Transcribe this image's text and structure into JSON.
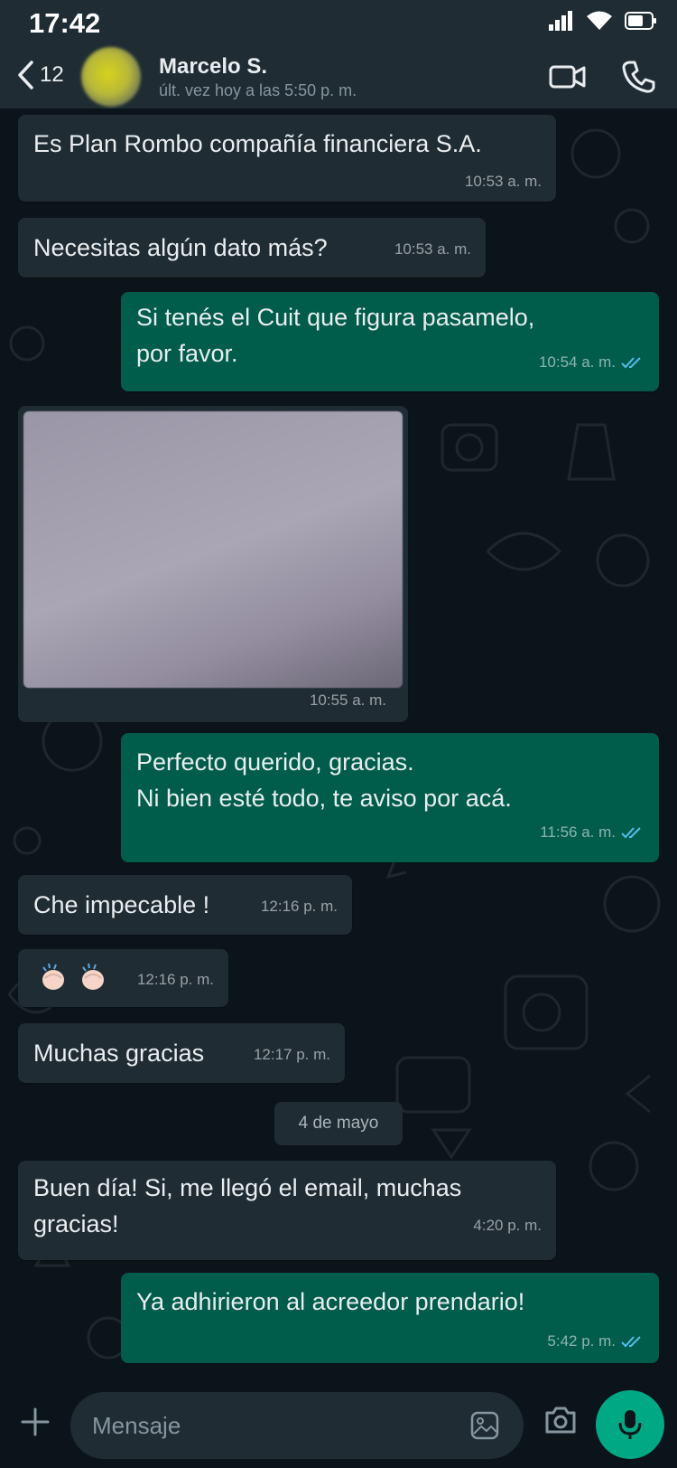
{
  "status_bar": {
    "time": "17:42"
  },
  "header": {
    "back_count": "12",
    "contact_name": "Marcelo S.",
    "last_seen": "últ. vez hoy a las 5:50 p. m."
  },
  "messages": [
    {
      "direction": "in",
      "text": "Es Plan Rombo compañía financiera S.A.",
      "time": "10:53 a. m."
    },
    {
      "direction": "in",
      "text": "Necesitas algún dato más?",
      "time": "10:53 a. m."
    },
    {
      "direction": "out",
      "text_lines": [
        "Si tenés el Cuit que figura pasamelo,",
        "por favor."
      ],
      "time": "10:54 a. m.",
      "read": true
    },
    {
      "direction": "in",
      "type": "image",
      "time": "10:55 a. m."
    },
    {
      "direction": "out",
      "text_lines": [
        "Perfecto querido, gracias.",
        "Ni bien esté todo, te aviso por acá."
      ],
      "time": "11:56 a. m.",
      "read": true
    },
    {
      "direction": "in",
      "text": "Che impecable !",
      "time": "12:16 p. m."
    },
    {
      "direction": "in",
      "type": "emoji",
      "emoji": [
        "clapping-hands",
        "clapping-hands"
      ],
      "time": "12:16 p. m."
    },
    {
      "direction": "in",
      "text": "Muchas gracias",
      "time": "12:17 p. m."
    },
    {
      "direction": "in",
      "text_lines": [
        "Buen día! Si, me llegó el email, muchas",
        "gracias!"
      ],
      "time": "4:20 p. m."
    },
    {
      "direction": "out",
      "text": "Ya adhirieron al acreedor prendario!",
      "time": "5:42 p. m.",
      "read": true
    }
  ],
  "date_separator": "4 de mayo",
  "input": {
    "placeholder": "Mensaje"
  },
  "colors": {
    "background": "#0b141a",
    "incoming_bubble": "#1f2c34",
    "outgoing_bubble": "#005c4b",
    "read_ticks": "#53bdeb",
    "mic_button": "#00a884"
  }
}
